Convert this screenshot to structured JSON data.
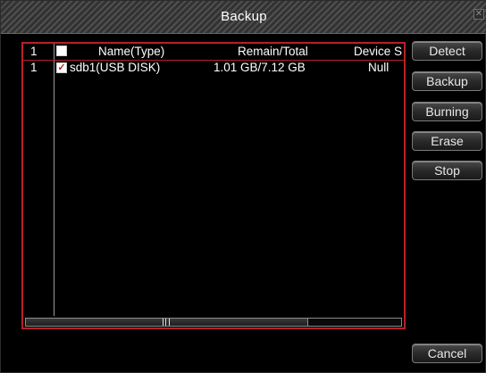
{
  "window": {
    "title": "Backup",
    "close_icon": "✕"
  },
  "table": {
    "header": {
      "index": "1",
      "select_all_checked": false,
      "name": "Name(Type)",
      "remain_total": "Remain/Total",
      "device_status": "Device S"
    },
    "rows": [
      {
        "index": "1",
        "checked": true,
        "check_glyph": "✓",
        "name": "sdb1(USB DISK)",
        "remain_total": "1.01 GB/7.12 GB",
        "device_status": "Null"
      }
    ]
  },
  "buttons": {
    "detect": "Detect",
    "backup": "Backup",
    "burning": "Burning",
    "erase": "Erase",
    "stop": "Stop",
    "cancel": "Cancel"
  },
  "colors": {
    "accent_frame": "#b8202a",
    "background": "#000000"
  }
}
